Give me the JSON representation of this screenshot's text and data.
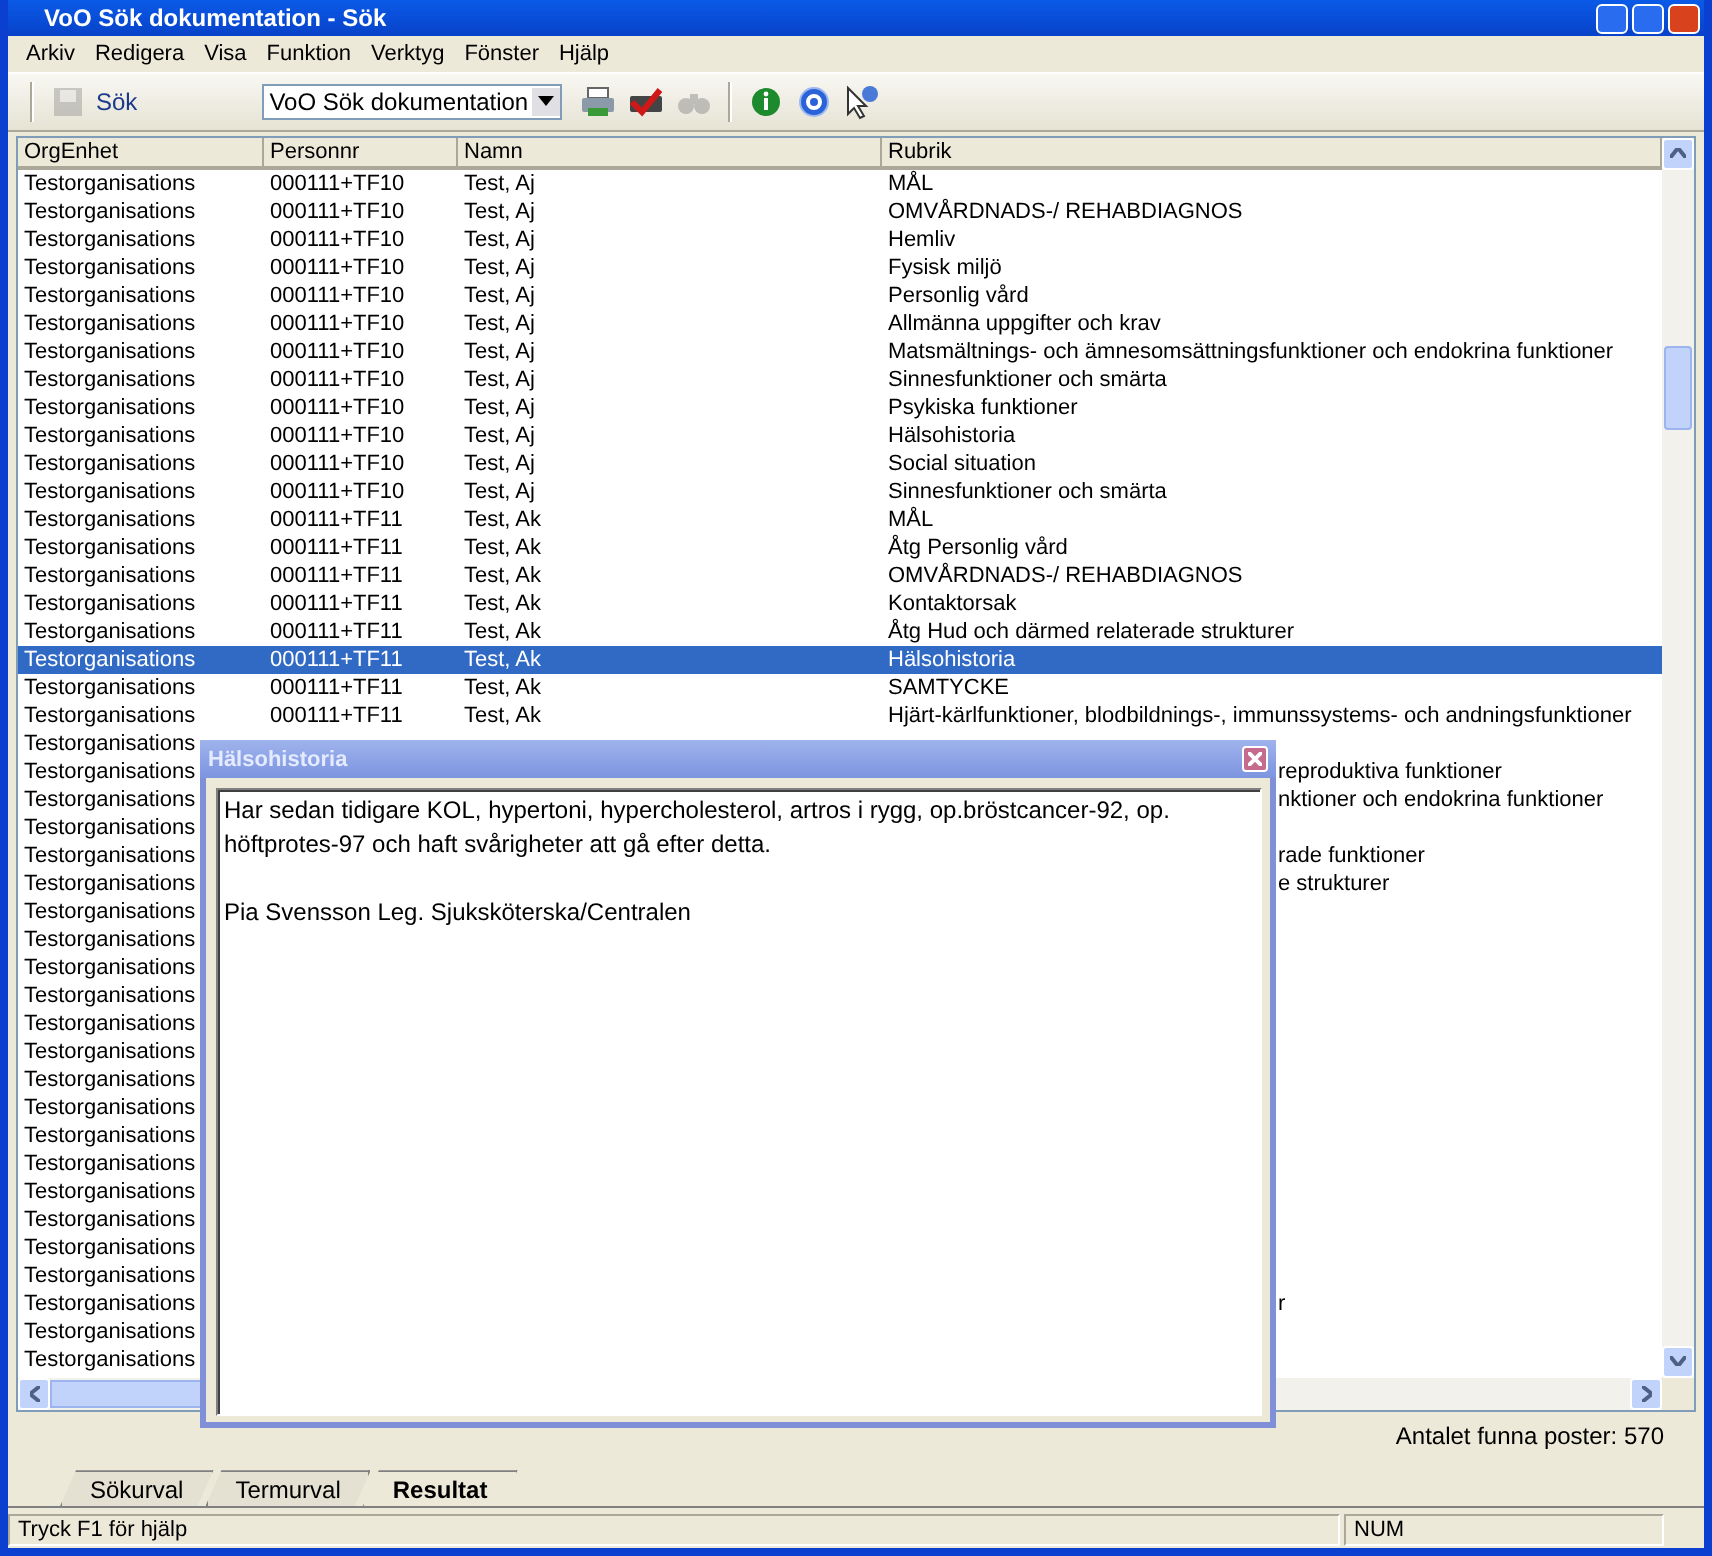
{
  "window": {
    "title": "VoO Sök dokumentation - Sök"
  },
  "menu": [
    "Arkiv",
    "Redigera",
    "Visa",
    "Funktion",
    "Verktyg",
    "Fönster",
    "Hjälp"
  ],
  "toolbar": {
    "label": "Sök",
    "combo_value": "VoO Sök dokumentation",
    "icons": [
      {
        "kind": "save",
        "disabled": true
      },
      {
        "kind": "print",
        "disabled": false
      },
      {
        "kind": "print-check",
        "disabled": false
      },
      {
        "kind": "binoculars",
        "disabled": true
      },
      {
        "kind": "info",
        "disabled": false
      },
      {
        "kind": "help",
        "disabled": false
      },
      {
        "kind": "whats-this",
        "disabled": false
      }
    ]
  },
  "table": {
    "columns": [
      "OrgEnhet",
      "Personnr",
      "Namn",
      "Rubrik"
    ],
    "rows": [
      {
        "kind": "full",
        "selected": false,
        "org": "Testorganisations",
        "personnr": "000111+TF10",
        "namn": "Test, Aj",
        "rubrik": "MÅL"
      },
      {
        "kind": "full",
        "selected": false,
        "org": "Testorganisations",
        "personnr": "000111+TF10",
        "namn": "Test, Aj",
        "rubrik": "OMVÅRDNADS-/ REHABDIAGNOS"
      },
      {
        "kind": "full",
        "selected": false,
        "org": "Testorganisations",
        "personnr": "000111+TF10",
        "namn": "Test, Aj",
        "rubrik": "Hemliv"
      },
      {
        "kind": "full",
        "selected": false,
        "org": "Testorganisations",
        "personnr": "000111+TF10",
        "namn": "Test, Aj",
        "rubrik": "Fysisk miljö"
      },
      {
        "kind": "full",
        "selected": false,
        "org": "Testorganisations",
        "personnr": "000111+TF10",
        "namn": "Test, Aj",
        "rubrik": "Personlig vård"
      },
      {
        "kind": "full",
        "selected": false,
        "org": "Testorganisations",
        "personnr": "000111+TF10",
        "namn": "Test, Aj",
        "rubrik": "Allmänna uppgifter och krav"
      },
      {
        "kind": "full",
        "selected": false,
        "org": "Testorganisations",
        "personnr": "000111+TF10",
        "namn": "Test, Aj",
        "rubrik": "Matsmältnings- och ämnesomsättningsfunktioner och endokrina funktioner"
      },
      {
        "kind": "full",
        "selected": false,
        "org": "Testorganisations",
        "personnr": "000111+TF10",
        "namn": "Test, Aj",
        "rubrik": "Sinnesfunktioner och smärta"
      },
      {
        "kind": "full",
        "selected": false,
        "org": "Testorganisations",
        "personnr": "000111+TF10",
        "namn": "Test, Aj",
        "rubrik": "Psykiska funktioner"
      },
      {
        "kind": "full",
        "selected": false,
        "org": "Testorganisations",
        "personnr": "000111+TF10",
        "namn": "Test, Aj",
        "rubrik": "Hälsohistoria"
      },
      {
        "kind": "full",
        "selected": false,
        "org": "Testorganisations",
        "personnr": "000111+TF10",
        "namn": "Test, Aj",
        "rubrik": "Social situation"
      },
      {
        "kind": "full",
        "selected": false,
        "org": "Testorganisations",
        "personnr": "000111+TF10",
        "namn": "Test, Aj",
        "rubrik": "Sinnesfunktioner och smärta"
      },
      {
        "kind": "full",
        "selected": false,
        "org": "Testorganisations",
        "personnr": "000111+TF11",
        "namn": "Test, Ak",
        "rubrik": "MÅL"
      },
      {
        "kind": "full",
        "selected": false,
        "org": "Testorganisations",
        "personnr": "000111+TF11",
        "namn": "Test, Ak",
        "rubrik": "Åtg Personlig vård"
      },
      {
        "kind": "full",
        "selected": false,
        "org": "Testorganisations",
        "personnr": "000111+TF11",
        "namn": "Test, Ak",
        "rubrik": "OMVÅRDNADS-/ REHABDIAGNOS"
      },
      {
        "kind": "full",
        "selected": false,
        "org": "Testorganisations",
        "personnr": "000111+TF11",
        "namn": "Test, Ak",
        "rubrik": "Kontaktorsak"
      },
      {
        "kind": "full",
        "selected": false,
        "org": "Testorganisations",
        "personnr": "000111+TF11",
        "namn": "Test, Ak",
        "rubrik": "Åtg Hud och därmed relaterade strukturer"
      },
      {
        "kind": "full",
        "selected": true,
        "org": "Testorganisations",
        "personnr": "000111+TF11",
        "namn": "Test, Ak",
        "rubrik": "Hälsohistoria"
      },
      {
        "kind": "full",
        "selected": false,
        "org": "Testorganisations",
        "personnr": "000111+TF11",
        "namn": "Test, Ak",
        "rubrik": "SAMTYCKE"
      },
      {
        "kind": "full",
        "selected": false,
        "org": "Testorganisations",
        "personnr": "000111+TF11",
        "namn": "Test, Ak",
        "rubrik": "Hjärt-kärlfunktioner, blodbildnings-, immunssystems- och andningsfunktioner"
      },
      {
        "kind": "covered",
        "selected": false,
        "org": "Testorganisations"
      },
      {
        "kind": "covered",
        "selected": false,
        "org": "Testorganisations",
        "rubrik": "reproduktiva funktioner"
      },
      {
        "kind": "covered",
        "selected": false,
        "org": "Testorganisations",
        "rubrik": "nktioner och endokrina funktioner"
      },
      {
        "kind": "covered",
        "selected": false,
        "org": "Testorganisations"
      },
      {
        "kind": "covered",
        "selected": false,
        "org": "Testorganisations",
        "rubrik": "rade funktioner"
      },
      {
        "kind": "covered",
        "selected": false,
        "org": "Testorganisations",
        "rubrik": "e strukturer"
      },
      {
        "kind": "covered",
        "selected": false,
        "org": "Testorganisations"
      },
      {
        "kind": "covered",
        "selected": false,
        "org": "Testorganisations"
      },
      {
        "kind": "covered",
        "selected": false,
        "org": "Testorganisations"
      },
      {
        "kind": "covered",
        "selected": false,
        "org": "Testorganisations"
      },
      {
        "kind": "covered",
        "selected": false,
        "org": "Testorganisations"
      },
      {
        "kind": "covered",
        "selected": false,
        "org": "Testorganisations"
      },
      {
        "kind": "covered",
        "selected": false,
        "org": "Testorganisations"
      },
      {
        "kind": "covered",
        "selected": false,
        "org": "Testorganisations"
      },
      {
        "kind": "covered",
        "selected": false,
        "org": "Testorganisations"
      },
      {
        "kind": "covered",
        "selected": false,
        "org": "Testorganisations"
      },
      {
        "kind": "covered",
        "selected": false,
        "org": "Testorganisations"
      },
      {
        "kind": "covered",
        "selected": false,
        "org": "Testorganisations"
      },
      {
        "kind": "covered",
        "selected": false,
        "org": "Testorganisations"
      },
      {
        "kind": "covered",
        "selected": false,
        "org": "Testorganisations"
      },
      {
        "kind": "covered",
        "selected": false,
        "org": "Testorganisations",
        "rubrik": "r"
      },
      {
        "kind": "covered",
        "selected": false,
        "org": "Testorganisations"
      },
      {
        "kind": "covered",
        "selected": false,
        "org": "Testorganisations"
      }
    ]
  },
  "result_count": "Antalet funna poster: 570",
  "tabs": [
    {
      "label": "Sökurval",
      "selected": false
    },
    {
      "label": "Termurval",
      "selected": false
    },
    {
      "label": "Resultat",
      "selected": true
    }
  ],
  "status_bar": {
    "help": "Tryck F1 för hjälp",
    "num": "NUM"
  },
  "popup": {
    "title": "Hälsohistoria",
    "paragraphs": [
      "Har sedan tidigare KOL, hypertoni, hypercholesterol, artros i rygg, op.bröstcancer-92, op. höftprotes-97 och haft svårigheter att gå efter detta.",
      "Pia Svensson Leg. Sjuksköterska/Centralen"
    ]
  }
}
